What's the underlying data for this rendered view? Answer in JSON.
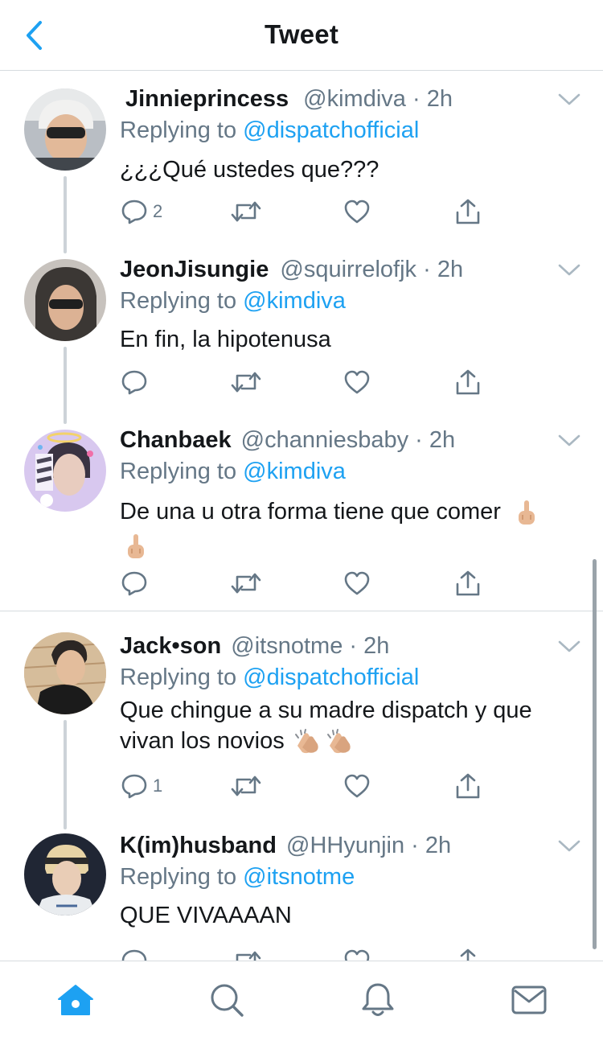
{
  "header": {
    "title": "Tweet"
  },
  "tweets": [
    {
      "name": "Jinnieprincess",
      "handle": "@kimdiva",
      "sep": " · ",
      "time": "2h",
      "replying_prefix": "Replying to ",
      "replying_to": "@dispatchofficial",
      "text": "¿¿¿Qué ustedes que???",
      "reply_count": "2"
    },
    {
      "name": "JeonJisungie",
      "handle": "@squirrelofjk",
      "sep": " · ",
      "time": "2h",
      "replying_prefix": "Replying to ",
      "replying_to": "@kimdiva",
      "text": "En fin, la hipotenusa",
      "reply_count": ""
    },
    {
      "name": "Chanbaek",
      "handle": "@channiesbaby",
      "sep": " · ",
      "time": "2h",
      "replying_prefix": "Replying to ",
      "replying_to": "@kimdiva",
      "text": "De una u otra forma tiene que comer",
      "reply_count": ""
    },
    {
      "name": "Jack•son",
      "handle": "@itsnotme",
      "sep": " · ",
      "time": "2h",
      "replying_prefix": "Replying to ",
      "replying_to": "@dispatchofficial",
      "text": "Que chingue a su madre dispatch y que vivan los novios",
      "reply_count": "1"
    },
    {
      "name": "K(im)husband",
      "handle": "@HHyunjin",
      "sep": " · ",
      "time": "2h",
      "replying_prefix": "Replying to ",
      "replying_to": "@itsnotme",
      "text": "QUE VIVAAAAN",
      "reply_count": ""
    }
  ],
  "icons": {
    "reply": "comment-icon",
    "retweet": "retweet-icon",
    "like": "heart-icon",
    "share": "share-icon"
  },
  "tabs": [
    "home-icon",
    "search-icon",
    "notifications-icon",
    "messages-icon"
  ],
  "colors": {
    "accent": "#1da1f2",
    "muted": "#657786",
    "text": "#14171a",
    "border": "#d6dbdf",
    "skin": "#e8b894"
  }
}
